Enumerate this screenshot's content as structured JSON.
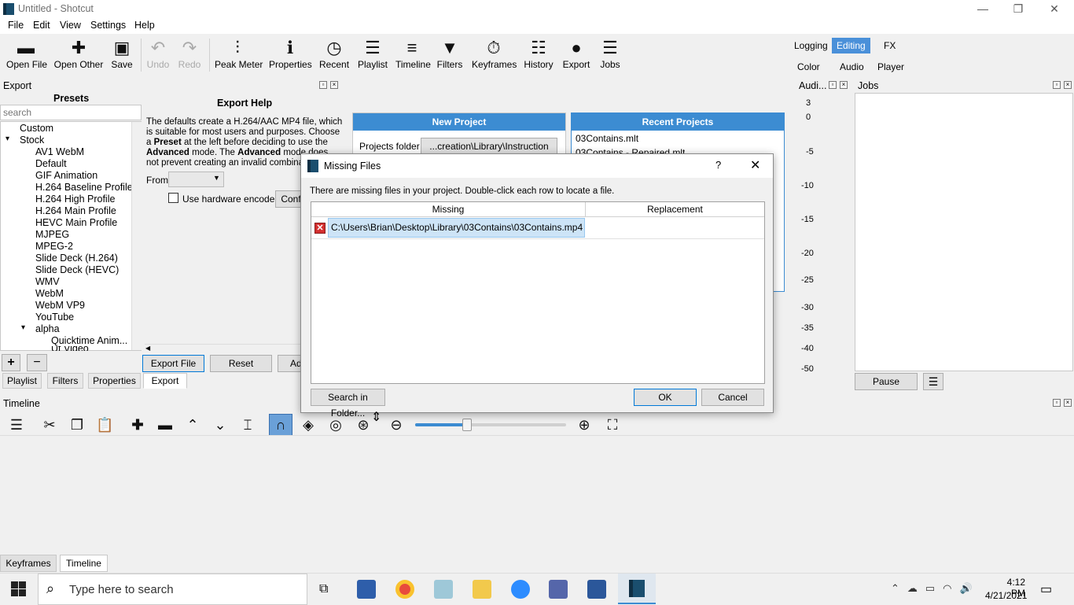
{
  "window": {
    "title": "Untitled - Shotcut",
    "minimize": "—",
    "restore": "❐",
    "close": "✕"
  },
  "menu": [
    "File",
    "Edit",
    "View",
    "Settings",
    "Help"
  ],
  "toolbar": [
    {
      "label": "Open File",
      "icon": "folder-icon",
      "glyph": "▬"
    },
    {
      "label": "Open Other",
      "icon": "open-other-icon",
      "glyph": "✚"
    },
    {
      "label": "Save",
      "icon": "save-icon",
      "glyph": "💾"
    },
    {
      "label": "Undo",
      "icon": "undo-icon",
      "glyph": "↶",
      "disabled": true
    },
    {
      "label": "Redo",
      "icon": "redo-icon",
      "glyph": "↷",
      "disabled": true
    },
    {
      "label": "Peak Meter",
      "icon": "peak-meter-icon",
      "glyph": "|||"
    },
    {
      "label": "Properties",
      "icon": "info-icon",
      "glyph": "ℹ"
    },
    {
      "label": "Recent",
      "icon": "clock-icon",
      "glyph": "◷"
    },
    {
      "label": "Playlist",
      "icon": "list-icon",
      "glyph": "☰"
    },
    {
      "label": "Timeline",
      "icon": "timeline-icon",
      "glyph": "≡"
    },
    {
      "label": "Filters",
      "icon": "funnel-icon",
      "glyph": "▼"
    },
    {
      "label": "Keyframes",
      "icon": "stopwatch-icon",
      "glyph": "⏱"
    },
    {
      "label": "History",
      "icon": "history-icon",
      "glyph": "☷"
    },
    {
      "label": "Export",
      "icon": "export-icon",
      "glyph": "●"
    },
    {
      "label": "Jobs",
      "icon": "jobs-icon",
      "glyph": "☰"
    }
  ],
  "layouts": {
    "row1": [
      "Logging",
      "Editing",
      "FX"
    ],
    "row2": [
      "Color",
      "Audio",
      "Player"
    ],
    "active": "Editing"
  },
  "export": {
    "panel_title": "Export",
    "presets_title": "Presets",
    "search_placeholder": "search",
    "presets": [
      "Custom",
      "Stock",
      "AV1 WebM",
      "Default",
      "GIF Animation",
      "H.264 Baseline Profile",
      "H.264 High Profile",
      "H.264 Main Profile",
      "HEVC Main Profile",
      "MJPEG",
      "MPEG-2",
      "Slide Deck (H.264)",
      "Slide Deck (HEVC)",
      "WMV",
      "WebM",
      "WebM VP9",
      "YouTube",
      "alpha",
      "Quicktime Anim...",
      "Ut Video"
    ],
    "help_title": "Export Help",
    "help_text_1": "The defaults create a H.264/AAC MP4 file, which is suitable for most users and purposes. Choose a",
    "help_bold_1": "Preset",
    "help_text_2": "at the left before deciding to use the",
    "help_bold_2": "Advanced",
    "help_text_3": "mode. The",
    "help_bold_3": "Advanced",
    "help_text_4": "mode does not prevent creating an invalid combination o",
    "from_label": "From",
    "hw_encoder_label": "Use hardware encoder",
    "configure_label": "Conf",
    "export_file": "Export File",
    "reset": "Reset",
    "advanced": "Ad",
    "add": "+",
    "remove": "−"
  },
  "start_panel": {
    "new_project": "New Project",
    "projects_folder_label": "Projects folder",
    "projects_folder_value": "...creation\\Library\\Instruction",
    "recent_projects": "Recent Projects",
    "recent": [
      "03Contains.mlt",
      "03Contains - Repaired.mlt"
    ]
  },
  "bottom_tabs": [
    "Playlist",
    "Filters",
    "Properties",
    "Export"
  ],
  "bottom_tabs_active": "Export",
  "audio": {
    "title": "Audi...",
    "scale": [
      "3",
      "0",
      "-5",
      "-10",
      "-15",
      "-20",
      "-25",
      "-30",
      "-35",
      "-40",
      "-50"
    ]
  },
  "jobs": {
    "title": "Jobs",
    "pause": "Pause",
    "menu": "☰"
  },
  "timeline": {
    "title": "Timeline"
  },
  "dialog": {
    "title": "Missing Files",
    "help": "?",
    "close": "✕",
    "message": "There are missing files in your project. Double-click each row to locate a file.",
    "col_missing": "Missing",
    "col_replacement": "Replacement",
    "rows": [
      {
        "missing": "C:\\Users\\Brian\\Desktop\\Library\\03Contains\\03Contains.mp4",
        "replacement": ""
      }
    ],
    "search_folder": "Search in Folder...",
    "ok": "OK",
    "cancel": "Cancel"
  },
  "bottom_dock_tabs": [
    "Keyframes",
    "Timeline"
  ],
  "bottom_dock_active": "Timeline",
  "taskbar": {
    "search_placeholder": "Type here to search",
    "time": "4:12 PM",
    "date": "4/21/2021"
  }
}
